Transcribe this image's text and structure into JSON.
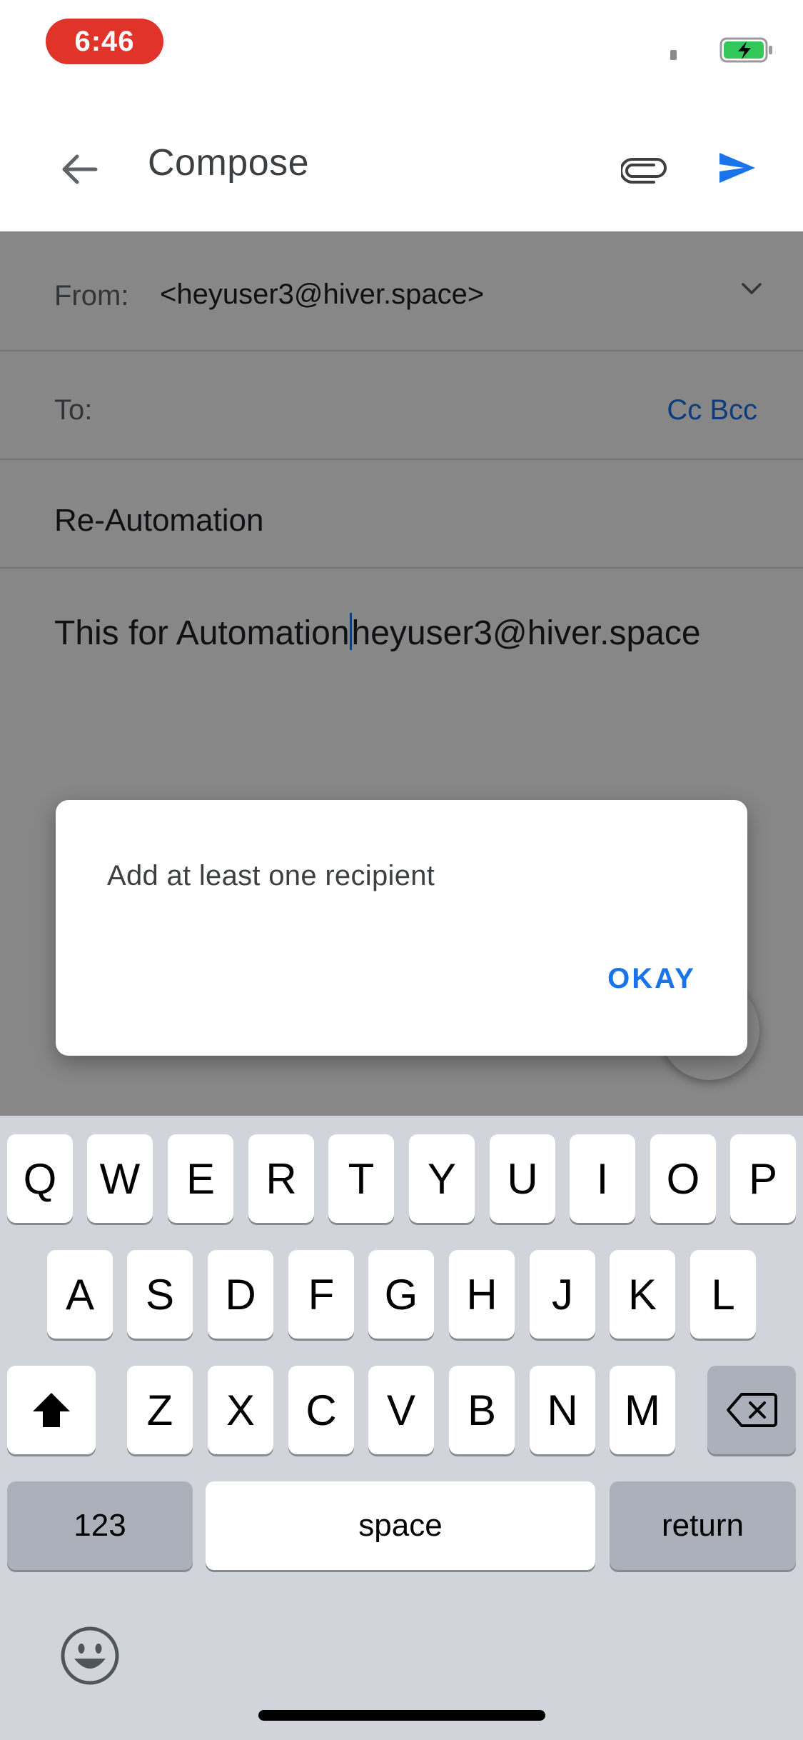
{
  "status_bar": {
    "time": "6:46"
  },
  "app_bar": {
    "title": "Compose"
  },
  "compose": {
    "from_label": "From:",
    "from_value": "<heyuser3@hiver.space>",
    "to_label": "To:",
    "cc_bcc_label": "Cc Bcc",
    "subject": "Re-Automation",
    "body_before_cursor": "This for Automation",
    "body_after_cursor": "heyuser3@hiver.space"
  },
  "dialog": {
    "message": "Add at least one recipient",
    "okay_label": "OKAY"
  },
  "keyboard": {
    "row1": [
      "Q",
      "W",
      "E",
      "R",
      "T",
      "Y",
      "U",
      "I",
      "O",
      "P"
    ],
    "row2": [
      "A",
      "S",
      "D",
      "F",
      "G",
      "H",
      "J",
      "K",
      "L"
    ],
    "row3": [
      "Z",
      "X",
      "C",
      "V",
      "B",
      "N",
      "M"
    ],
    "numbers_label": "123",
    "space_label": "space",
    "return_label": "return"
  },
  "colors": {
    "accent": "#1a73e8",
    "time_pill": "#e0332a",
    "keyboard_bg": "#d1d4db",
    "battery": "#34c759"
  }
}
